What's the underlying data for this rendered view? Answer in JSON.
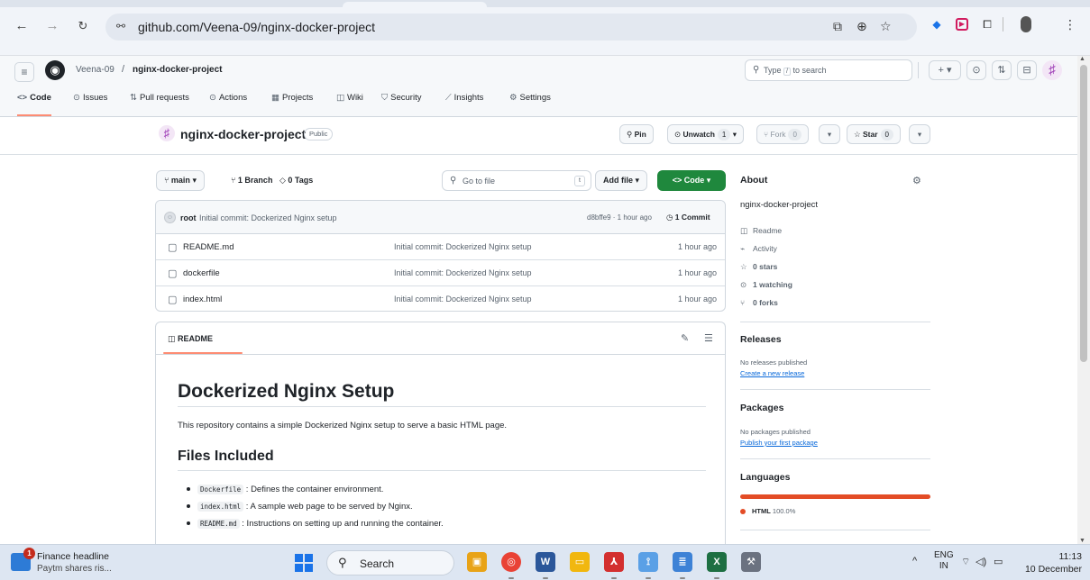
{
  "browser": {
    "url": "github.com/Veena-09/nginx-docker-project"
  },
  "header": {
    "owner": "Veena-09",
    "separator": "/",
    "repo": "nginx-docker-project",
    "search_prefix": "Type",
    "search_key": "/",
    "search_suffix": "to search"
  },
  "repo_nav": [
    {
      "label": "Code",
      "icon": "<>"
    },
    {
      "label": "Issues",
      "icon": "⊙"
    },
    {
      "label": "Pull requests",
      "icon": "⇅"
    },
    {
      "label": "Actions",
      "icon": "⊙"
    },
    {
      "label": "Projects",
      "icon": "▦"
    },
    {
      "label": "Wiki",
      "icon": "◫"
    },
    {
      "label": "Security",
      "icon": "⛉"
    },
    {
      "label": "Insights",
      "icon": "⟋"
    },
    {
      "label": "Settings",
      "icon": "⚙"
    }
  ],
  "repo": {
    "name": "nginx-docker-project",
    "visibility": "Public",
    "pin_label": "Pin",
    "unwatch_label": "Unwatch",
    "watch_count": "1",
    "fork_label": "Fork",
    "fork_count": "0",
    "star_label": "Star",
    "star_count": "0"
  },
  "toolbar": {
    "branch": "main",
    "branch_count_label": "1 Branch",
    "tags_label": "0 Tags",
    "goto_placeholder": "Go to file",
    "goto_key": "t",
    "add_file_label": "Add file",
    "code_label": "Code"
  },
  "commit": {
    "author": "root",
    "message": "Initial commit: Dockerized Nginx setup",
    "hash_time": "d8bffe9 · 1 hour ago",
    "count_label": "1 Commit"
  },
  "files": [
    {
      "name": "README.md",
      "message": "Initial commit: Dockerized Nginx setup",
      "time": "1 hour ago"
    },
    {
      "name": "dockerfile",
      "message": "Initial commit: Dockerized Nginx setup",
      "time": "1 hour ago"
    },
    {
      "name": "index.html",
      "message": "Initial commit: Dockerized Nginx setup",
      "time": "1 hour ago"
    }
  ],
  "readme": {
    "tab_label": "README",
    "h1": "Dockerized Nginx Setup",
    "intro": "This repository contains a simple Dockerized Nginx setup to serve a basic HTML page.",
    "h2": "Files Included",
    "items": [
      {
        "code": "Dockerfile",
        "text": ": Defines the container environment."
      },
      {
        "code": "index.html",
        "text": ": A sample web page to be served by Nginx."
      },
      {
        "code": "README.md",
        "text": ": Instructions on setting up and running the container."
      }
    ]
  },
  "about": {
    "heading": "About",
    "description": "nginx-docker-project",
    "readme_label": "Readme",
    "activity_label": "Activity",
    "stars_label": "0 stars",
    "watching_label": "1 watching",
    "forks_label": "0 forks"
  },
  "releases": {
    "heading": "Releases",
    "empty": "No releases published",
    "link": "Create a new release"
  },
  "packages": {
    "heading": "Packages",
    "empty": "No packages published",
    "link": "Publish your first package"
  },
  "languages": {
    "heading": "Languages",
    "name": "HTML",
    "percent": "100.0%",
    "share": 1.0,
    "color": "#e34c26"
  },
  "taskbar": {
    "news_badge": "1",
    "news_title": "Finance headline",
    "news_subtitle": "Paytm shares ris...",
    "search_label": "Search",
    "lang_top": "ENG",
    "lang_bottom": "IN",
    "time": "11:13",
    "date": "10 December"
  },
  "colors": {
    "code_button": "#1f883d",
    "active_tab_underline": "#fd8c73",
    "link": "#0969da"
  }
}
